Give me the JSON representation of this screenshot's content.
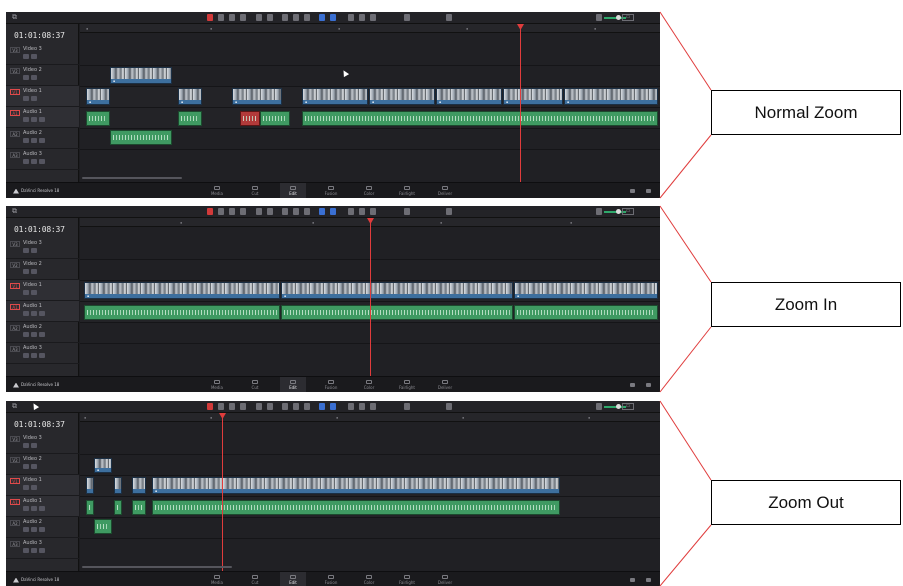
{
  "panels": [
    {
      "id": "normal",
      "callout": "Normal Zoom",
      "timecode": "01:01:08:37",
      "tracks": [
        {
          "badge": "V3",
          "name": "Video 3",
          "active": false
        },
        {
          "badge": "V2",
          "name": "Video 2",
          "active": false
        },
        {
          "badge": "V1",
          "name": "Video 1",
          "active": true
        },
        {
          "badge": "A1",
          "name": "Audio 1",
          "active": true
        },
        {
          "badge": "A2",
          "name": "Audio 2",
          "active": false
        },
        {
          "badge": "A3",
          "name": "Audio 3",
          "active": false
        }
      ]
    },
    {
      "id": "zoom-in",
      "callout": "Zoom In",
      "timecode": "01:01:08:37",
      "tracks": [
        {
          "badge": "V3",
          "name": "Video 3",
          "active": false
        },
        {
          "badge": "V2",
          "name": "Video 2",
          "active": false
        },
        {
          "badge": "V1",
          "name": "Video 1",
          "active": true
        },
        {
          "badge": "A1",
          "name": "Audio 1",
          "active": true
        },
        {
          "badge": "A2",
          "name": "Audio 2",
          "active": false
        },
        {
          "badge": "A3",
          "name": "Audio 3",
          "active": false
        }
      ]
    },
    {
      "id": "zoom-out",
      "callout": "Zoom Out",
      "timecode": "01:01:08:37",
      "tracks": [
        {
          "badge": "V3",
          "name": "Video 3",
          "active": false
        },
        {
          "badge": "V2",
          "name": "Video 2",
          "active": false
        },
        {
          "badge": "V1",
          "name": "Video 1",
          "active": true
        },
        {
          "badge": "A1",
          "name": "Audio 1",
          "active": true
        },
        {
          "badge": "A2",
          "name": "Audio 2",
          "active": false
        },
        {
          "badge": "A3",
          "name": "Audio 3",
          "active": false
        }
      ]
    }
  ],
  "app": {
    "brand": "DaVinci Resolve 18"
  },
  "page_tabs": [
    "Media",
    "Cut",
    "Edit",
    "Fusion",
    "Color",
    "Fairlight",
    "Deliver"
  ],
  "active_page_tab": "Edit",
  "colors": {
    "video_clip": "#3d6f9e",
    "audio_clip": "#3f9a62",
    "playhead": "#e03c3c",
    "connector": "#e03c3c"
  },
  "icons": [
    "snap-icon",
    "blade-icon",
    "link-icon",
    "flag-icon",
    "marker-icon",
    "zoom-icon",
    "volume-icon",
    "resolve-logo-icon",
    "home-icon",
    "settings-icon"
  ]
}
